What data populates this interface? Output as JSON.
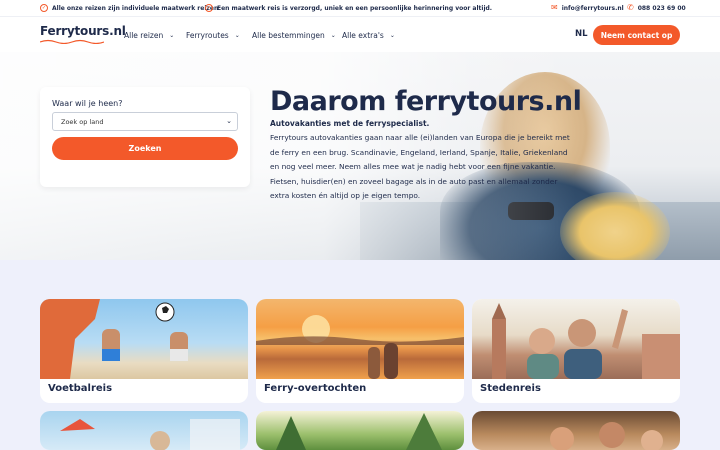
{
  "topbar": {
    "usp1": "Alle onze reizen zijn individuele maatwerk reizen",
    "usp2": "Een maatwerk reis is verzorgd, uniek en een persoonlijke herinnering voor altijd.",
    "email": "info@ferrytours.nl",
    "phone": "088 023 69 00",
    "icons": {
      "check": "check-circle-icon",
      "mail": "mail-icon",
      "phone": "phone-icon"
    }
  },
  "nav": {
    "logo": "Ferrytours.nl",
    "menu": [
      "Alle reizen",
      "Ferryroutes",
      "Alle bestemmingen",
      "Alle extra's"
    ],
    "language": "NL",
    "contact": "Neem contact op"
  },
  "search": {
    "label": "Waar wil je heen?",
    "placeholder": "Zoek op land",
    "button": "Zoeken"
  },
  "hero": {
    "title": "Daarom ferrytours.nl",
    "subtitle": "Autovakanties met de ferryspecialist.",
    "body": "Ferrytours autovakanties gaan naar alle (ei)landen van Europa die je bereikt met de ferry en een brug. Scandinavie, Engeland, Ierland, Spanje, Italie, Griekenland en nog veel meer. Neem alles mee wat je nadig hebt voor een fijne vakantie. Fietsen, huisdier(en) en zoveel bagage als in de auto past en allemaal zonder extra kosten én altijd op je eigen tempo."
  },
  "cards": [
    {
      "title": "Voetbalreis"
    },
    {
      "title": "Ferry-overtochten"
    },
    {
      "title": "Stedenreis"
    }
  ],
  "colors": {
    "accent": "#f3592a",
    "navy": "#1e2a4a",
    "background": "#eef0fb"
  }
}
